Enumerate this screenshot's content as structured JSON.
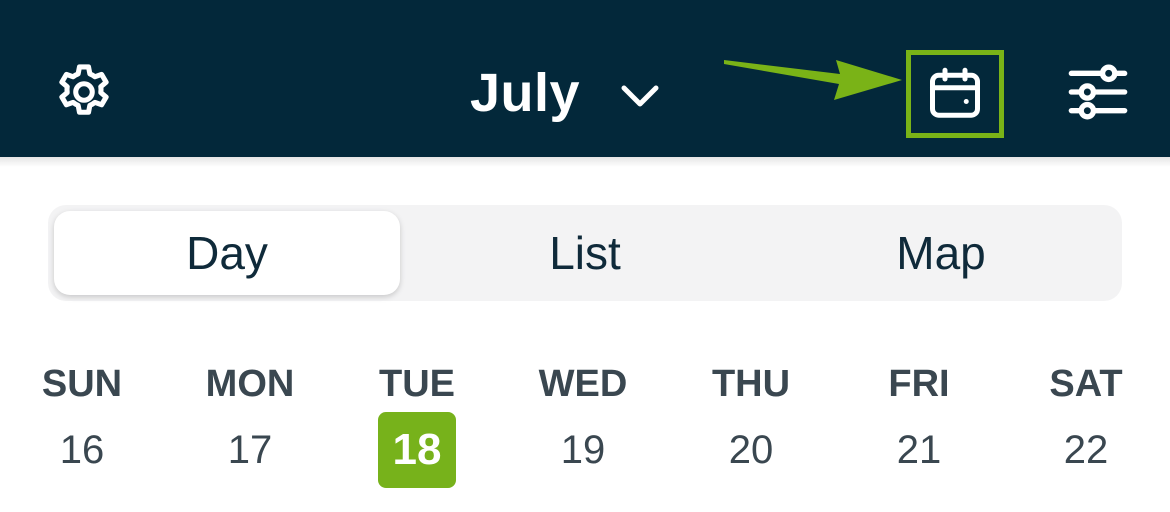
{
  "header": {
    "month": "July",
    "icons": {
      "settings": "gear-icon",
      "month_toggle": "chevron-down-icon",
      "calendar": "calendar-icon",
      "filters": "sliders-icon"
    },
    "colors": {
      "background": "#03283a",
      "highlight": "#7ab317"
    }
  },
  "view_tabs": [
    {
      "label": "Day",
      "active": true
    },
    {
      "label": "List",
      "active": false
    },
    {
      "label": "Map",
      "active": false
    }
  ],
  "week": {
    "days": [
      {
        "dow": "SUN",
        "date": "16"
      },
      {
        "dow": "MON",
        "date": "17"
      },
      {
        "dow": "TUE",
        "date": "18"
      },
      {
        "dow": "WED",
        "date": "19"
      },
      {
        "dow": "THU",
        "date": "20"
      },
      {
        "dow": "FRI",
        "date": "21"
      },
      {
        "dow": "SAT",
        "date": "22"
      }
    ],
    "selected_date": "18",
    "selected_color": "#77b21b"
  }
}
